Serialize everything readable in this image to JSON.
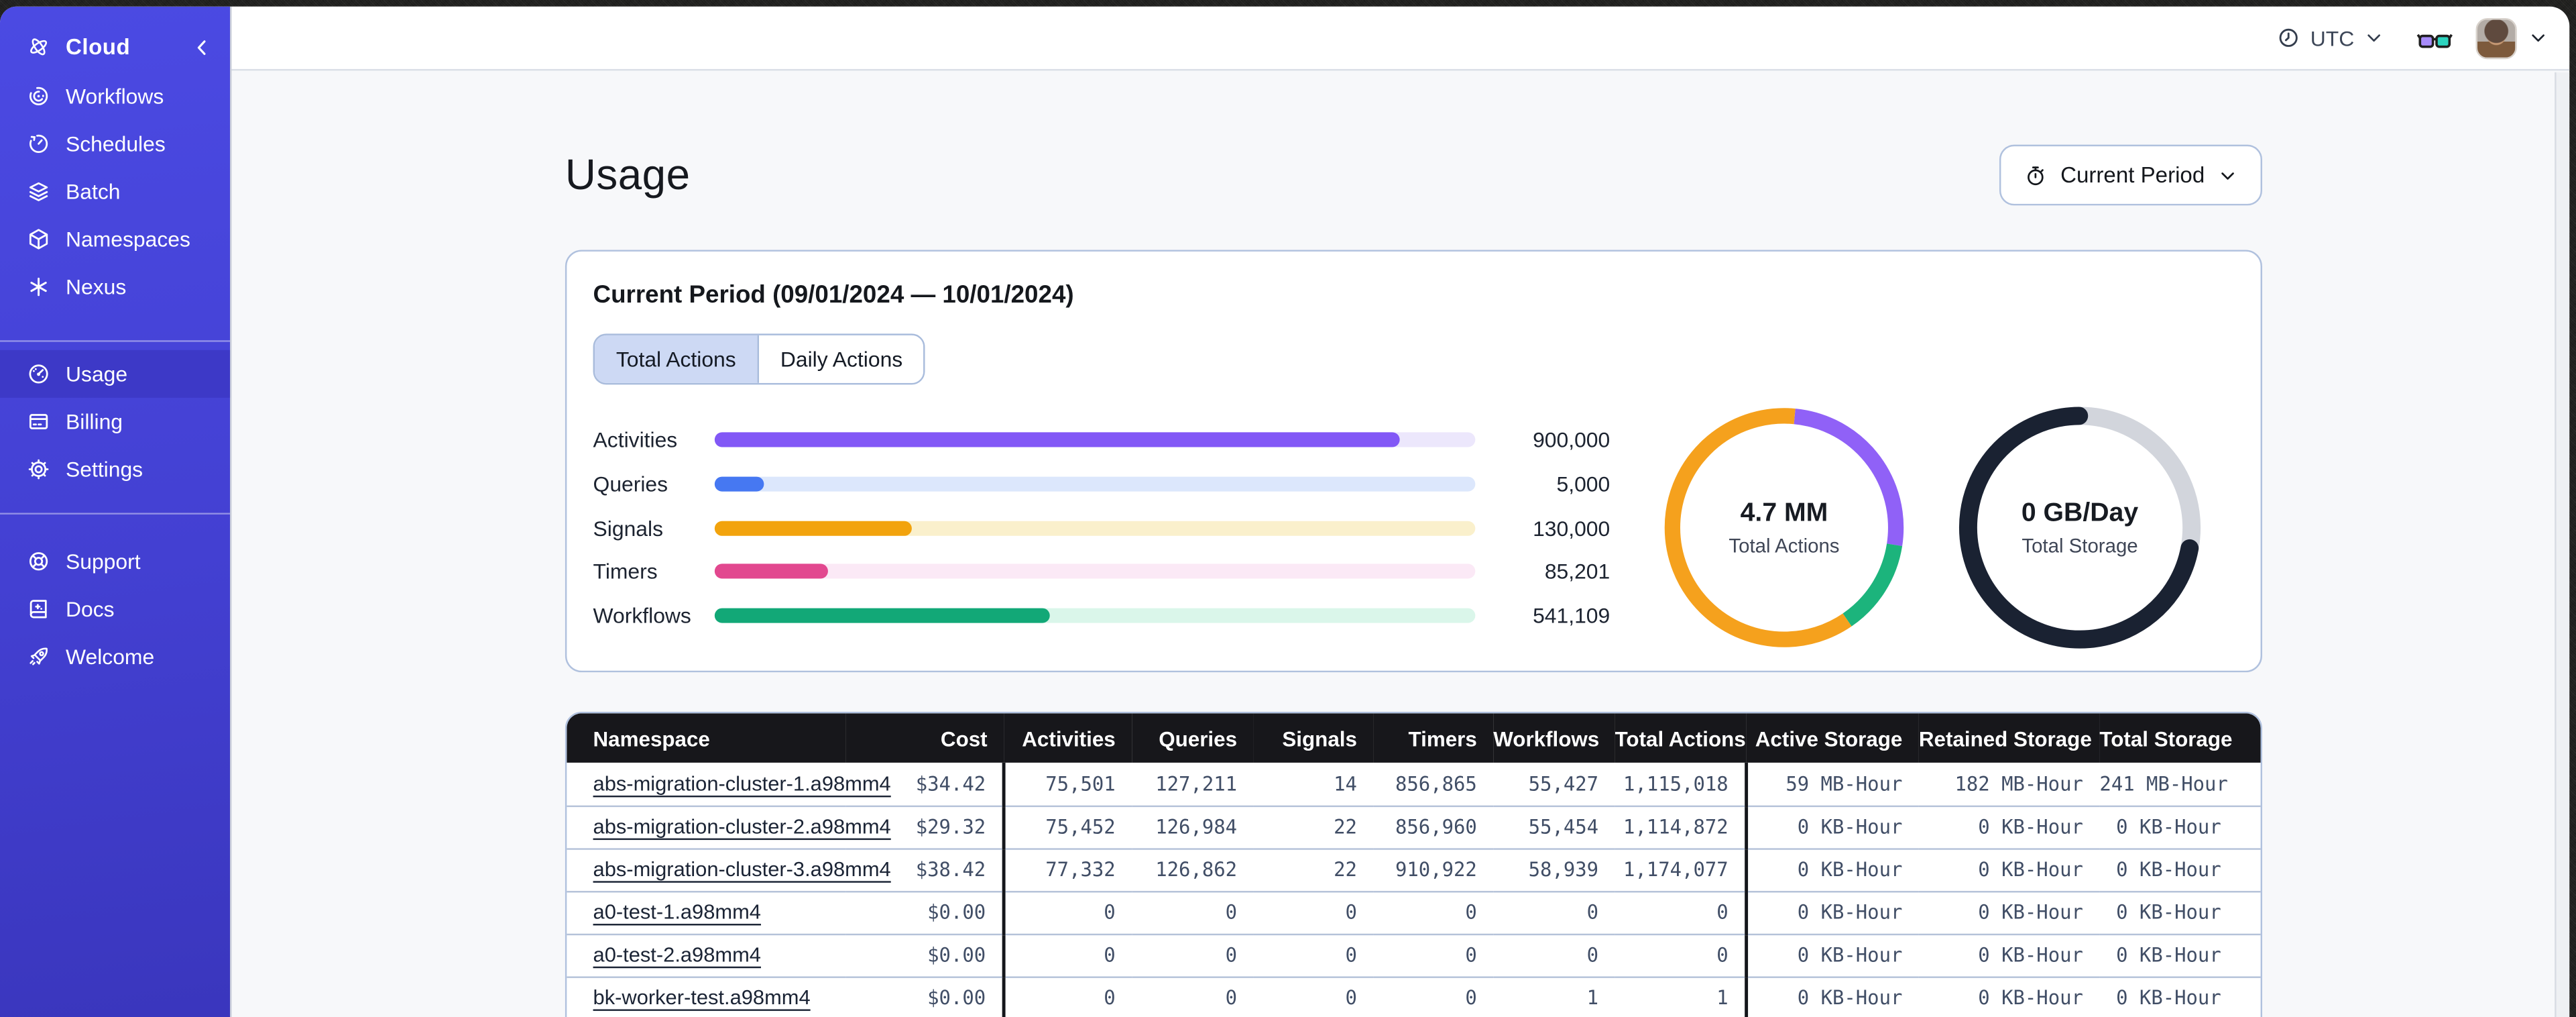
{
  "topbar": {
    "timezone": "UTC",
    "icons": [
      "clock-icon",
      "chevron-down-icon",
      "reading-glasses-icon",
      "user-avatar",
      "chevron-down-icon"
    ]
  },
  "sidebar": {
    "brand": "Cloud",
    "brand_icon": "temporal-logo-icon",
    "collapse_icon": "chevron-left-icon",
    "groups": [
      {
        "items": [
          {
            "label": "Workflows",
            "icon": "workflows-icon"
          },
          {
            "label": "Schedules",
            "icon": "schedules-icon"
          },
          {
            "label": "Batch",
            "icon": "batch-icon"
          },
          {
            "label": "Namespaces",
            "icon": "namespaces-icon"
          },
          {
            "label": "Nexus",
            "icon": "nexus-icon"
          }
        ]
      },
      {
        "items": [
          {
            "label": "Usage",
            "icon": "usage-icon",
            "active": true
          },
          {
            "label": "Billing",
            "icon": "billing-icon"
          },
          {
            "label": "Settings",
            "icon": "settings-icon"
          }
        ]
      },
      {
        "items": [
          {
            "label": "Support",
            "icon": "support-icon"
          },
          {
            "label": "Docs",
            "icon": "docs-icon"
          },
          {
            "label": "Welcome",
            "icon": "welcome-icon"
          }
        ]
      }
    ]
  },
  "page": {
    "title": "Usage",
    "period_button_label": "Current Period"
  },
  "usage_card": {
    "title": "Current Period (09/01/2024 — 10/01/2024)",
    "tabs": [
      {
        "label": "Total Actions",
        "selected": true
      },
      {
        "label": "Daily Actions",
        "selected": false
      }
    ]
  },
  "chart_data": [
    {
      "type": "bar",
      "orientation": "horizontal",
      "categories": [
        "Activities",
        "Queries",
        "Signals",
        "Timers",
        "Workflows"
      ],
      "values": [
        900000,
        5000,
        130000,
        85201,
        541109
      ],
      "display_values": [
        "900,000",
        "5,000",
        "130,000",
        "85,201",
        "541,109"
      ],
      "fill_fractions": [
        0.9,
        0.065,
        0.26,
        0.15,
        0.44
      ],
      "colors": [
        "#8258f6",
        "#4678f2",
        "#f2a30d",
        "#e2488f",
        "#12a877"
      ],
      "track_colors": [
        "#ece7fc",
        "#dce7fc",
        "#faf0cc",
        "#fbe9f6",
        "#daf6ea"
      ]
    },
    {
      "type": "donut",
      "center_value": "4.7 MM",
      "center_caption": "Total Actions",
      "segments": [
        {
          "name": "purple",
          "color": "#9061f7",
          "start": 1.5,
          "length": 26
        },
        {
          "name": "green",
          "color": "#1cb47c",
          "start": 27.5,
          "length": 13
        },
        {
          "name": "orange",
          "color": "#f5a11d",
          "start": 40.5,
          "length": 61
        }
      ]
    },
    {
      "type": "donut",
      "center_value": "0 GB/Day",
      "center_caption": "Total Storage",
      "segments": [
        {
          "name": "gray",
          "color": "#d2d5dc",
          "start": 0,
          "length": 28
        },
        {
          "name": "navy",
          "color": "#1a2232",
          "start": 28,
          "length": 72,
          "cap": "round"
        }
      ]
    }
  ],
  "table": {
    "columns": [
      "Namespace",
      "Cost",
      "Activities",
      "Queries",
      "Signals",
      "Timers",
      "Workflows",
      "Total Actions",
      "Active Storage",
      "Retained Storage",
      "Total Storage"
    ],
    "rows": [
      {
        "namespace": "abs-migration-cluster-1.a98mm4",
        "values": [
          "$34.42",
          "75,501",
          "127,211",
          "14",
          "856,865",
          "55,427",
          "1,115,018",
          "59 MB-Hour",
          "182 MB-Hour",
          "241 MB-Hour"
        ]
      },
      {
        "namespace": "abs-migration-cluster-2.a98mm4",
        "values": [
          "$29.32",
          "75,452",
          "126,984",
          "22",
          "856,960",
          "55,454",
          "1,114,872",
          "0 KB-Hour",
          "0 KB-Hour",
          "0 KB-Hour"
        ]
      },
      {
        "namespace": "abs-migration-cluster-3.a98mm4",
        "values": [
          "$38.42",
          "77,332",
          "126,862",
          "22",
          "910,922",
          "58,939",
          "1,174,077",
          "0 KB-Hour",
          "0 KB-Hour",
          "0 KB-Hour"
        ]
      },
      {
        "namespace": "a0-test-1.a98mm4",
        "values": [
          "$0.00",
          "0",
          "0",
          "0",
          "0",
          "0",
          "0",
          "0 KB-Hour",
          "0 KB-Hour",
          "0 KB-Hour"
        ]
      },
      {
        "namespace": "a0-test-2.a98mm4",
        "values": [
          "$0.00",
          "0",
          "0",
          "0",
          "0",
          "0",
          "0",
          "0 KB-Hour",
          "0 KB-Hour",
          "0 KB-Hour"
        ]
      },
      {
        "namespace": "bk-worker-test.a98mm4",
        "values": [
          "$0.00",
          "0",
          "0",
          "0",
          "0",
          "1",
          "1",
          "0 KB-Hour",
          "0 KB-Hour",
          "0 KB-Hour"
        ]
      }
    ]
  }
}
